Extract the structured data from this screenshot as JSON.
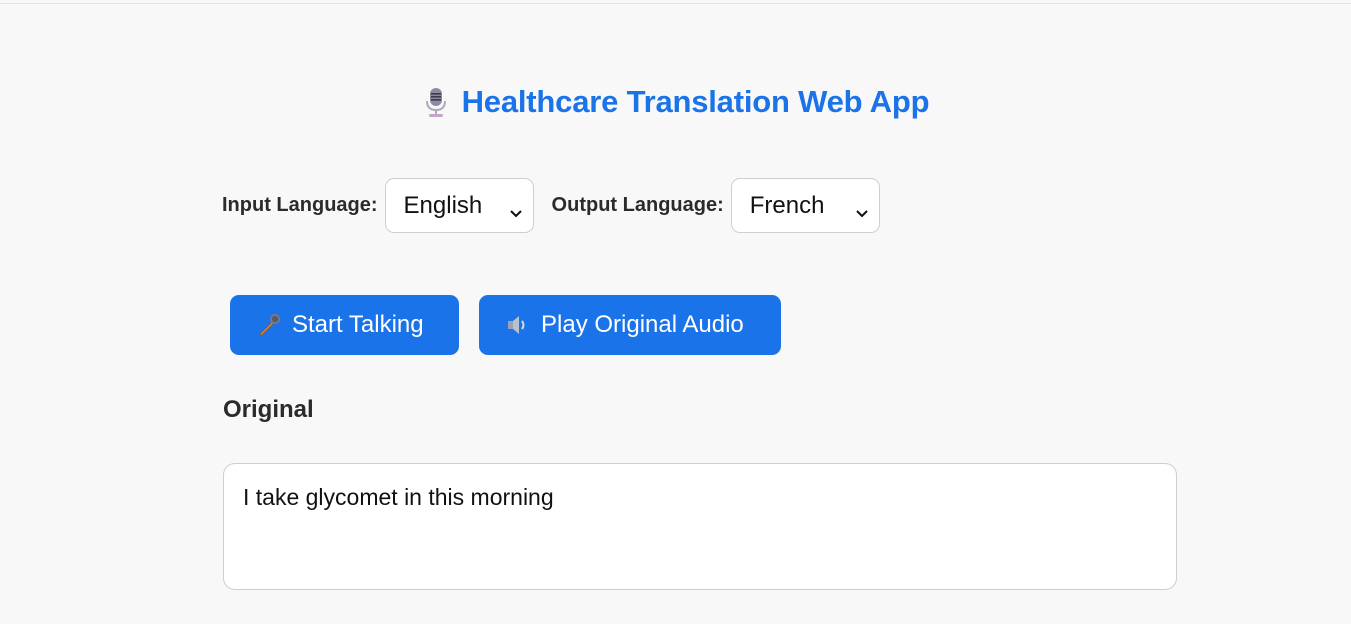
{
  "app": {
    "title": "Healthcare Translation Web App",
    "title_icon": "studio-microphone-icon",
    "accent_color": "#1a73e8"
  },
  "languages": {
    "input_label": "Input Language:",
    "input_selected": "English",
    "output_label": "Output Language:",
    "output_selected": "French"
  },
  "actions": {
    "start_label": "Start Talking",
    "start_icon": "microphone-icon",
    "play_label": "Play Original Audio",
    "play_icon": "speaker-icon"
  },
  "original": {
    "heading": "Original",
    "text": "I take glycomet in this morning"
  }
}
